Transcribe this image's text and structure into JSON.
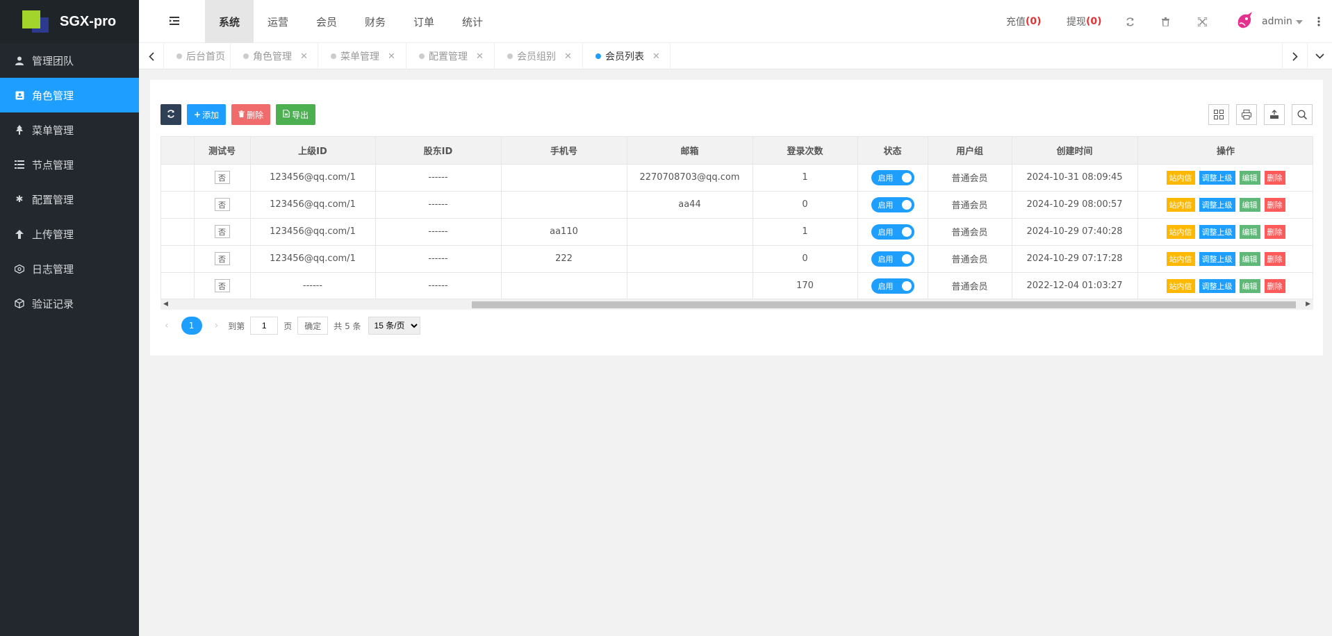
{
  "brand": {
    "name": "SGX-pro"
  },
  "sidebar": {
    "items": [
      {
        "label": "管理团队",
        "icon": "user-icon"
      },
      {
        "label": "角色管理",
        "icon": "id-card-icon",
        "active": true
      },
      {
        "label": "菜单管理",
        "icon": "tree-icon"
      },
      {
        "label": "节点管理",
        "icon": "list-icon"
      },
      {
        "label": "配置管理",
        "icon": "asterisk-icon"
      },
      {
        "label": "上传管理",
        "icon": "arrow-up-icon"
      },
      {
        "label": "日志管理",
        "icon": "log-icon"
      },
      {
        "label": "验证记录",
        "icon": "cube-icon"
      }
    ]
  },
  "header": {
    "tabs": [
      "系统",
      "运营",
      "会员",
      "财务",
      "订单",
      "统计"
    ],
    "recharge_label": "充值",
    "recharge_count": "(0)",
    "withdraw_label": "提现",
    "withdraw_count": "(0)",
    "username": "admin"
  },
  "page_tabs": [
    {
      "label": "后台首页",
      "closable": false
    },
    {
      "label": "角色管理",
      "closable": true
    },
    {
      "label": "菜单管理",
      "closable": true
    },
    {
      "label": "配置管理",
      "closable": true
    },
    {
      "label": "会员组别",
      "closable": true
    },
    {
      "label": "会员列表",
      "closable": true,
      "active": true
    }
  ],
  "toolbar": {
    "add_label": "添加",
    "delete_label": "删除",
    "export_label": "导出"
  },
  "table": {
    "columns": [
      "",
      "测试号",
      "上级ID",
      "股东ID",
      "手机号",
      "邮箱",
      "登录次数",
      "状态",
      "用户组",
      "创建时间",
      "操作"
    ],
    "rows": [
      {
        "test": "否",
        "parent": "123456@qq.com/1",
        "shareholder": "------",
        "phone": "",
        "email": "2270708703@qq.com",
        "logins": "1",
        "status": "启用",
        "group": "普通会员",
        "created": "2024-10-31 08:09:45"
      },
      {
        "test": "否",
        "parent": "123456@qq.com/1",
        "shareholder": "------",
        "phone": "",
        "email": "aa44",
        "logins": "0",
        "status": "启用",
        "group": "普通会员",
        "created": "2024-10-29 08:00:57"
      },
      {
        "test": "否",
        "parent": "123456@qq.com/1",
        "shareholder": "------",
        "phone": "aa110",
        "email": "",
        "logins": "1",
        "status": "启用",
        "group": "普通会员",
        "created": "2024-10-29 07:40:28"
      },
      {
        "test": "否",
        "parent": "123456@qq.com/1",
        "shareholder": "------",
        "phone": "222",
        "email": "",
        "logins": "0",
        "status": "启用",
        "group": "普通会员",
        "created": "2024-10-29 07:17:28"
      },
      {
        "test": "否",
        "parent": "------",
        "shareholder": "------",
        "phone": "",
        "email": "",
        "logins": "170",
        "status": "启用",
        "group": "普通会员",
        "created": "2022-12-04 01:03:27"
      }
    ],
    "actions": [
      "站内信",
      "调整上级",
      "编辑",
      "删除"
    ]
  },
  "pager": {
    "current_page": "1",
    "goto_label": "到第",
    "goto_value": "1",
    "page_unit": "页",
    "confirm_label": "确定",
    "total_label": "共 5 条",
    "page_size": "15 条/页"
  },
  "colors": {
    "accent": "#1e9fff",
    "sidebar_bg": "#23282e",
    "warn": "#ffb800",
    "success": "#5fb878",
    "danger": "#ff5a5a"
  }
}
